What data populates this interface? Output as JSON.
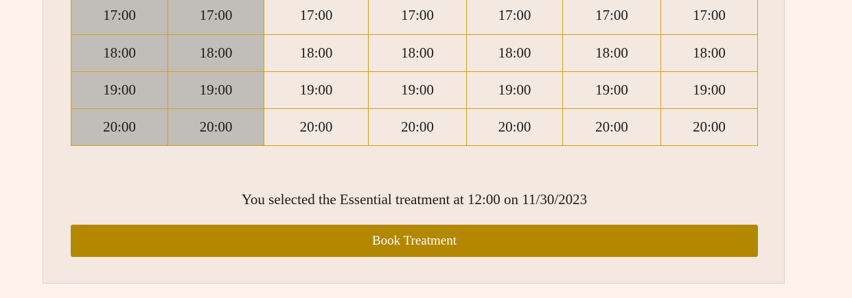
{
  "schedule": {
    "rows": [
      {
        "cells": [
          {
            "time": "17:00",
            "available": false
          },
          {
            "time": "17:00",
            "available": false
          },
          {
            "time": "17:00",
            "available": true
          },
          {
            "time": "17:00",
            "available": true
          },
          {
            "time": "17:00",
            "available": true
          },
          {
            "time": "17:00",
            "available": true
          },
          {
            "time": "17:00",
            "available": true
          }
        ]
      },
      {
        "cells": [
          {
            "time": "18:00",
            "available": false
          },
          {
            "time": "18:00",
            "available": false
          },
          {
            "time": "18:00",
            "available": true
          },
          {
            "time": "18:00",
            "available": true
          },
          {
            "time": "18:00",
            "available": true
          },
          {
            "time": "18:00",
            "available": true
          },
          {
            "time": "18:00",
            "available": true
          }
        ]
      },
      {
        "cells": [
          {
            "time": "19:00",
            "available": false
          },
          {
            "time": "19:00",
            "available": false
          },
          {
            "time": "19:00",
            "available": true
          },
          {
            "time": "19:00",
            "available": true
          },
          {
            "time": "19:00",
            "available": true
          },
          {
            "time": "19:00",
            "available": true
          },
          {
            "time": "19:00",
            "available": true
          }
        ]
      },
      {
        "cells": [
          {
            "time": "20:00",
            "available": false
          },
          {
            "time": "20:00",
            "available": false
          },
          {
            "time": "20:00",
            "available": true
          },
          {
            "time": "20:00",
            "available": true
          },
          {
            "time": "20:00",
            "available": true
          },
          {
            "time": "20:00",
            "available": true
          },
          {
            "time": "20:00",
            "available": true
          }
        ]
      }
    ]
  },
  "summary": {
    "text": "You selected the Essential treatment at 12:00 on 11/30/2023"
  },
  "actions": {
    "book_label": "Book Treatment"
  },
  "colors": {
    "page_background": "#fdf3ec",
    "panel_background": "#f3e9e1",
    "unavailable_cell": "#c1bdb9",
    "grid_border": "#d4a017",
    "button_background": "#b38800",
    "button_text": "#ffffff"
  }
}
